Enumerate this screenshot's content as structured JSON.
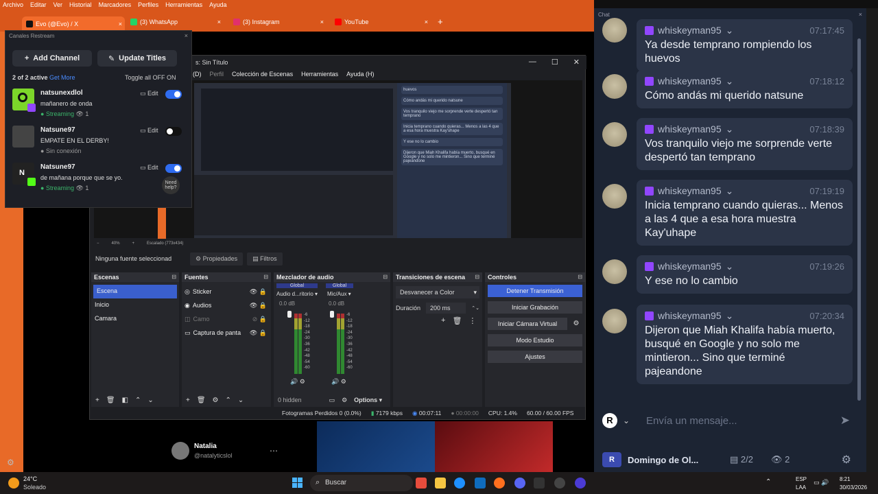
{
  "browser": {
    "menu": [
      "Archivo",
      "Editar",
      "Ver",
      "Historial",
      "Marcadores",
      "Perfiles",
      "Herramientas",
      "Ayuda"
    ],
    "tabs": [
      {
        "label": "Evo (@Evo) / X",
        "color": "#ffffff"
      },
      {
        "label": "(3) WhatsApp",
        "color": "#25d366"
      },
      {
        "label": "(3) Instagram",
        "color": "#e1306c"
      },
      {
        "label": "YouTube",
        "color": "#ff0000"
      }
    ],
    "new_tab": "+"
  },
  "restream": {
    "title": "Canales Restream",
    "close": "×",
    "add_channel": "Add Channel",
    "update_titles": "Update Titles",
    "active_count": "2 of 2 active",
    "get_more": "Get More",
    "toggle_all": "Toggle all OFF ON",
    "edit_label": "Edit",
    "need_help": "Need help?",
    "channels": [
      {
        "name": "natsunexdlol",
        "desc": "mañanero de onda",
        "status": "Streaming",
        "viewers": "1",
        "on": true
      },
      {
        "name": "Natsune97",
        "desc": "EMPATE EN EL DERBY!",
        "status": "Sin conexión",
        "viewers": "",
        "on": false
      },
      {
        "name": "Natsune97",
        "desc": "de mañana porque que se yo.",
        "status": "Streaming",
        "viewers": "1",
        "on": true
      }
    ]
  },
  "obs": {
    "title": "s: Sin Título",
    "menu": [
      "(D)",
      "Perfil",
      "Colección de Escenas",
      "Herramientas",
      "Ayuda (H)"
    ],
    "zoom": "40%",
    "scaling": "Escalado (773x434)",
    "no_source": "Ninguna fuente seleccionad",
    "properties": "Propiedades",
    "filters": "Filtros",
    "scenes_title": "Escenas",
    "scenes": [
      "Escena",
      "Inicio",
      "Camara"
    ],
    "sources_title": "Fuentes",
    "sources": [
      "Sticker",
      "Audios",
      "Camo",
      "Captura de panta"
    ],
    "mixer_title": "Mezclador de audio",
    "mixer_global": "Global",
    "mixer_ch1": "Audio d...ritorio",
    "mixer_ch2": "Mic/Aux",
    "mixer_db": "0.0 dB",
    "mixer_hidden": "0 hidden",
    "mixer_options": "Options",
    "meter_labels": [
      "-6",
      "-12",
      "-18",
      "-24",
      "-30",
      "-36",
      "-42",
      "-48",
      "-54",
      "-60"
    ],
    "transitions_title": "Transiciones de escena",
    "transition": "Desvanecer a Color",
    "duration_label": "Duración",
    "duration": "200 ms",
    "controls_title": "Controles",
    "controls": [
      "Detener Transmisión",
      "Iniciar Grabación",
      "Iniciar Cámara Virtual",
      "Modo Estudio",
      "Ajustes"
    ],
    "status": {
      "dropped": "Fotogramas Perdidos 0 (0.0%)",
      "kbps": "7179 kbps",
      "live": "00:07:11",
      "rec": "00:00:00",
      "cpu": "CPU: 1.4%",
      "fps": "60.00 / 60.00 FPS"
    }
  },
  "below": {
    "user_name": "Natalia",
    "user_handle": "@natalyticslol"
  },
  "chat": {
    "title": "Chat",
    "close": "×",
    "messages": [
      {
        "user": "whiskeyman95",
        "time": "07:17:45",
        "text": "Ya desde temprano rompiendo los huevos"
      },
      {
        "user": "whiskeyman95",
        "time": "07:18:12",
        "text": "Cómo andás mi querido natsune"
      },
      {
        "user": "whiskeyman95",
        "time": "07:18:39",
        "text": "Vos tranquilo viejo me sorprende verte despertó tan temprano"
      },
      {
        "user": "whiskeyman95",
        "time": "07:19:19",
        "text": "Inicia temprano cuando quieras... Menos a las 4 que a esa hora muestra Kay'uhape"
      },
      {
        "user": "whiskeyman95",
        "time": "07:19:26",
        "text": "Y ese no lo cambio"
      },
      {
        "user": "whiskeyman95",
        "time": "07:20:34",
        "text": "Dijeron que Miah Khalifa había muerto, busqué en Google y no solo me mintieron... Sino que terminé pajeandone"
      }
    ],
    "placeholder": "Envía un mensaje...",
    "channel": "Domingo de Ol...",
    "count_active": "2/2",
    "viewers": "2"
  },
  "taskbar": {
    "temp": "24°C",
    "weather": "Soleado",
    "search": "Buscar",
    "lang1": "ESP",
    "lang2": "LAA",
    "time": "8:21",
    "date": "30/03/2026"
  }
}
